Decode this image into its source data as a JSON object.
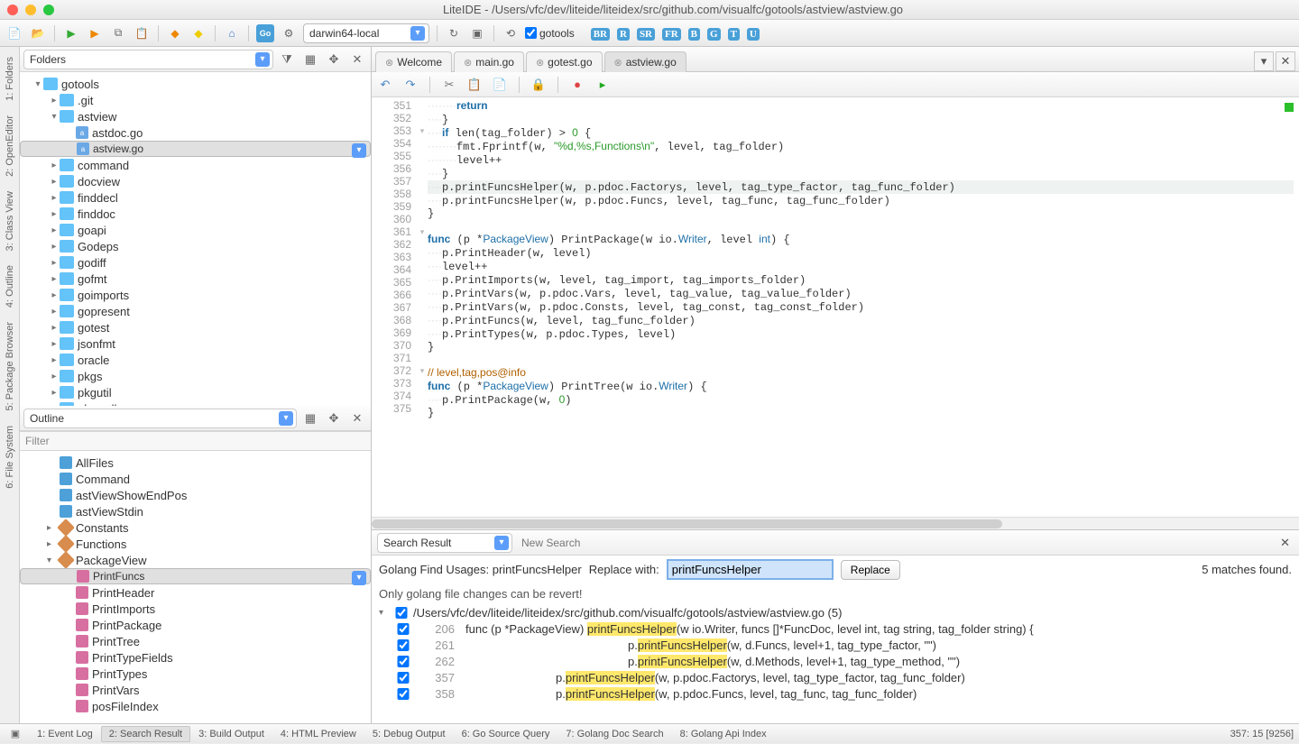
{
  "title": "LiteIDE - /Users/vfc/dev/liteide/liteidex/src/github.com/visualfc/gotools/astview/astview.go",
  "target_selector": {
    "value": "darwin64-local"
  },
  "toolbar_badges": [
    "BR",
    "R",
    "SR",
    "FR",
    "B",
    "G",
    "T",
    "U"
  ],
  "gotools_check_label": "gotools",
  "tabs": [
    {
      "label": "Welcome",
      "active": false
    },
    {
      "label": "main.go",
      "active": false
    },
    {
      "label": "gotest.go",
      "active": false
    },
    {
      "label": "astview.go",
      "active": true
    }
  ],
  "folders_panel": {
    "title": "Folders",
    "tree": [
      {
        "depth": 0,
        "arrow": "▾",
        "icon": "folder",
        "label": "gotools"
      },
      {
        "depth": 1,
        "arrow": "▸",
        "icon": "folder",
        "label": ".git"
      },
      {
        "depth": 1,
        "arrow": "▾",
        "icon": "folder",
        "label": "astview"
      },
      {
        "depth": 2,
        "arrow": "",
        "icon": "go",
        "label": "astdoc.go"
      },
      {
        "depth": 2,
        "arrow": "",
        "icon": "go",
        "label": "astview.go",
        "selected": true
      },
      {
        "depth": 1,
        "arrow": "▸",
        "icon": "folder",
        "label": "command"
      },
      {
        "depth": 1,
        "arrow": "▸",
        "icon": "folder",
        "label": "docview"
      },
      {
        "depth": 1,
        "arrow": "▸",
        "icon": "folder",
        "label": "finddecl"
      },
      {
        "depth": 1,
        "arrow": "▸",
        "icon": "folder",
        "label": "finddoc"
      },
      {
        "depth": 1,
        "arrow": "▸",
        "icon": "folder",
        "label": "goapi"
      },
      {
        "depth": 1,
        "arrow": "▸",
        "icon": "folder",
        "label": "Godeps"
      },
      {
        "depth": 1,
        "arrow": "▸",
        "icon": "folder",
        "label": "godiff"
      },
      {
        "depth": 1,
        "arrow": "▸",
        "icon": "folder",
        "label": "gofmt"
      },
      {
        "depth": 1,
        "arrow": "▸",
        "icon": "folder",
        "label": "goimports"
      },
      {
        "depth": 1,
        "arrow": "▸",
        "icon": "folder",
        "label": "gopresent"
      },
      {
        "depth": 1,
        "arrow": "▸",
        "icon": "folder",
        "label": "gotest"
      },
      {
        "depth": 1,
        "arrow": "▸",
        "icon": "folder",
        "label": "jsonfmt"
      },
      {
        "depth": 1,
        "arrow": "▸",
        "icon": "folder",
        "label": "oracle"
      },
      {
        "depth": 1,
        "arrow": "▸",
        "icon": "folder",
        "label": "pkgs"
      },
      {
        "depth": 1,
        "arrow": "▸",
        "icon": "folder",
        "label": "pkgutil"
      },
      {
        "depth": 1,
        "arrow": "▸",
        "icon": "folder",
        "label": "pkgwalk"
      }
    ]
  },
  "outline_panel": {
    "title": "Outline",
    "filter_placeholder": "Filter",
    "items": [
      {
        "depth": 0,
        "arrow": "",
        "icon": "blue",
        "label": "AllFiles"
      },
      {
        "depth": 0,
        "arrow": "",
        "icon": "blue",
        "label": "Command"
      },
      {
        "depth": 0,
        "arrow": "",
        "icon": "blue",
        "label": "astViewShowEndPos"
      },
      {
        "depth": 0,
        "arrow": "",
        "icon": "blue",
        "label": "astViewStdin"
      },
      {
        "depth": 0,
        "arrow": "▸",
        "icon": "orange",
        "label": "Constants"
      },
      {
        "depth": 0,
        "arrow": "▸",
        "icon": "orange",
        "label": "Functions"
      },
      {
        "depth": 0,
        "arrow": "▾",
        "icon": "orange",
        "label": "PackageView"
      },
      {
        "depth": 1,
        "arrow": "",
        "icon": "pink",
        "label": "PrintFuncs",
        "selected": true
      },
      {
        "depth": 1,
        "arrow": "",
        "icon": "pink",
        "label": "PrintHeader"
      },
      {
        "depth": 1,
        "arrow": "",
        "icon": "pink",
        "label": "PrintImports"
      },
      {
        "depth": 1,
        "arrow": "",
        "icon": "pink",
        "label": "PrintPackage"
      },
      {
        "depth": 1,
        "arrow": "",
        "icon": "pink",
        "label": "PrintTree"
      },
      {
        "depth": 1,
        "arrow": "",
        "icon": "pink",
        "label": "PrintTypeFields"
      },
      {
        "depth": 1,
        "arrow": "",
        "icon": "pink",
        "label": "PrintTypes"
      },
      {
        "depth": 1,
        "arrow": "",
        "icon": "pink",
        "label": "PrintVars"
      },
      {
        "depth": 1,
        "arrow": "",
        "icon": "pink",
        "label": "posFileIndex"
      }
    ]
  },
  "code": {
    "first_line": 351,
    "lines": [
      {
        "fold": "",
        "html": "<span class='ws'>········</span><span class='kw'>return</span>"
      },
      {
        "fold": "",
        "html": "<span class='ws'>····</span>}"
      },
      {
        "fold": "▾",
        "html": "<span class='ws'>····</span><span class='kw'>if</span> len(tag_folder) &gt; <span class='num'>0</span> {"
      },
      {
        "fold": "",
        "html": "<span class='ws'>········</span>fmt.Fprintf(w, <span class='str'>\"%d,%s,Functions\\n\"</span>, level, tag_folder)"
      },
      {
        "fold": "",
        "html": "<span class='ws'>········</span>level++"
      },
      {
        "fold": "",
        "html": "<span class='ws'>····</span>}"
      },
      {
        "fold": "",
        "hl": true,
        "html": "<span class='ws'>····</span>p.printFuncsHelper(w, p.pdoc.Factorys, level, tag_type_factor, tag_func_folder)"
      },
      {
        "fold": "",
        "html": "<span class='ws'>····</span>p.printFuncsHelper(w, p.pdoc.Funcs, level, tag_func, tag_func_folder)"
      },
      {
        "fold": "",
        "html": "}"
      },
      {
        "fold": "",
        "html": ""
      },
      {
        "fold": "▾",
        "html": "<span class='kw'>func</span> (p *<span class='typ'>PackageView</span>) PrintPackage(w io.<span class='typ'>Writer</span>, level <span class='typ'>int</span>) {"
      },
      {
        "fold": "",
        "html": "<span class='ws'>····</span>p.PrintHeader(w, level)"
      },
      {
        "fold": "",
        "html": "<span class='ws'>····</span>level++"
      },
      {
        "fold": "",
        "html": "<span class='ws'>····</span>p.PrintImports(w, level, tag_import, tag_imports_folder)"
      },
      {
        "fold": "",
        "html": "<span class='ws'>····</span>p.PrintVars(w, p.pdoc.Vars, level, tag_value, tag_value_folder)"
      },
      {
        "fold": "",
        "html": "<span class='ws'>····</span>p.PrintVars(w, p.pdoc.Consts, level, tag_const, tag_const_folder)"
      },
      {
        "fold": "",
        "html": "<span class='ws'>····</span>p.PrintFuncs(w, level, tag_func_folder)"
      },
      {
        "fold": "",
        "html": "<span class='ws'>····</span>p.PrintTypes(w, p.pdoc.Types, level)"
      },
      {
        "fold": "",
        "html": "}"
      },
      {
        "fold": "",
        "html": ""
      },
      {
        "fold": "",
        "html": "<span class='cmt'>// level,tag,pos@info</span>"
      },
      {
        "fold": "▾",
        "html": "<span class='kw'>func</span> (p *<span class='typ'>PackageView</span>) PrintTree(w io.<span class='typ'>Writer</span>) {"
      },
      {
        "fold": "",
        "html": "<span class='ws'>····</span>p.PrintPackage(w, <span class='num'>0</span>)"
      },
      {
        "fold": "",
        "html": "}"
      },
      {
        "fold": "",
        "html": ""
      }
    ]
  },
  "search": {
    "dropdown": "Search Result",
    "new_search": "New Search",
    "label": "Golang Find Usages:  printFuncsHelper",
    "replace_label": "Replace with:",
    "replace_value": "printFuncsHelper",
    "replace_btn": "Replace",
    "matches": "5 matches found.",
    "note": "Only golang file changes can be revert!",
    "file_header": "/Users/vfc/dev/liteide/liteidex/src/github.com/visualfc/gotools/astview/astview.go (5)",
    "results": [
      {
        "line": 206,
        "pre": "func (p *PackageView) ",
        "match": "printFuncsHelper",
        "post": "(w io.Writer, funcs []*FuncDoc, level int, tag string, tag_folder string) {"
      },
      {
        "line": 261,
        "pre": "p.",
        "match": "printFuncsHelper",
        "post": "(w, d.Funcs, level+1, tag_type_factor, \"\")",
        "indent": 180
      },
      {
        "line": 262,
        "pre": "p.",
        "match": "printFuncsHelper",
        "post": "(w, d.Methods, level+1, tag_type_method, \"\")",
        "indent": 180
      },
      {
        "line": 357,
        "pre": "p.",
        "match": "printFuncsHelper",
        "post": "(w, p.pdoc.Factorys, level, tag_type_factor, tag_func_folder)",
        "indent": 100
      },
      {
        "line": 358,
        "pre": "p.",
        "match": "printFuncsHelper",
        "post": "(w, p.pdoc.Funcs, level, tag_func, tag_func_folder)",
        "indent": 100
      }
    ]
  },
  "sidetabs": [
    "1: Folders",
    "2: OpenEditor",
    "3: Class View",
    "4: Outline",
    "5: Package Browser",
    "6: File System"
  ],
  "bottom_tabs": [
    "1: Event Log",
    "2: Search Result",
    "3: Build Output",
    "4: HTML Preview",
    "5: Debug Output",
    "6: Go Source Query",
    "7: Golang Doc Search",
    "8: Golang Api Index"
  ],
  "bottom_active": 1,
  "status": "357: 15  [9256]"
}
